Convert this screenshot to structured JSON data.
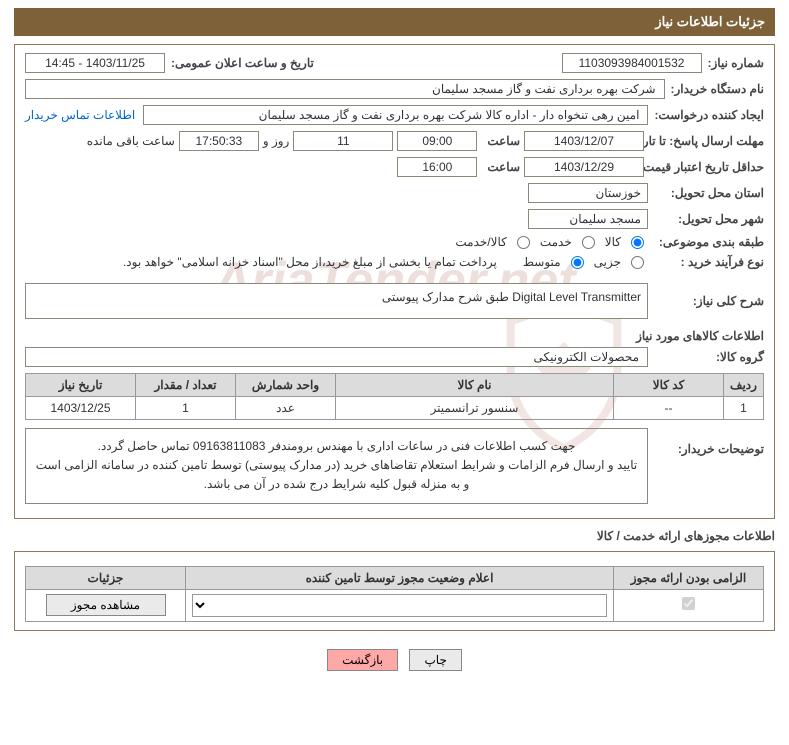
{
  "header": {
    "title": "جزئیات اطلاعات نیاز"
  },
  "need": {
    "number_label": "شماره نیاز:",
    "number": "1103093984001532",
    "announce_label": "تاریخ و ساعت اعلان عمومی:",
    "announce": "1403/11/25 - 14:45",
    "buyer_org_label": "نام دستگاه خریدار:",
    "buyer_org": "شرکت بهره برداری نفت و گاز مسجد سلیمان",
    "requester_label": "ایجاد کننده درخواست:",
    "requester": "امین رهی تنخواه دار - اداره کالا  شرکت بهره برداری نفت و گاز مسجد سلیمان",
    "buyer_contact_link": "اطلاعات تماس خریدار",
    "resp_deadline_label": "مهلت ارسال پاسخ: تا تاریخ:",
    "resp_date": "1403/12/07",
    "time_label": "ساعت",
    "resp_time": "09:00",
    "days": "11",
    "days_after": "روز و",
    "countdown": "17:50:33",
    "remaining_label": "ساعت باقی مانده",
    "price_validity_label": "حداقل تاریخ اعتبار قیمت: تا تاریخ:",
    "price_date": "1403/12/29",
    "price_time": "16:00",
    "province_label": "استان محل تحویل:",
    "province": "خوزستان",
    "city_label": "شهر محل تحویل:",
    "city": "مسجد سلیمان",
    "class_label": "طبقه بندی موضوعی:",
    "class_opts": {
      "goods": "کالا",
      "service": "خدمت",
      "both": "کالا/خدمت"
    },
    "process_label": "نوع فرآیند خرید :",
    "process_opts": {
      "partial": "جزیی",
      "medium": "متوسط"
    },
    "process_note": "پرداخت تمام یا بخشی از مبلغ خرید،از محل \"اسناد خزانه اسلامی\" خواهد بود.",
    "desc_label": "شرح کلی نیاز:",
    "desc": "Digital Level Transmitter طبق شرح مدارک پیوستی",
    "goods_info_title": "اطلاعات کالاهای مورد نیاز",
    "group_label": "گروه کالا:",
    "group": "محصولات الکترونیکی"
  },
  "table": {
    "headers": {
      "row": "ردیف",
      "code": "کد کالا",
      "name": "نام کالا",
      "unit": "واحد شمارش",
      "qty": "تعداد / مقدار",
      "date": "تاریخ نیاز"
    },
    "rows": [
      {
        "row": "1",
        "code": "--",
        "name": "سنسور ترانسمیتر",
        "unit": "عدد",
        "qty": "1",
        "date": "1403/12/25"
      }
    ]
  },
  "notes": {
    "label": "توضیحات خریدار:",
    "line1": "جهت کسب اطلاعات فنی در ساعات اداری با مهندس برومندفر  09163811083  تماس حاصل گردد.",
    "line2": "تایید و ارسال فرم الزامات و شرایط استعلام تقاضاهای خرید (در مدارک پیوستی) توسط تامین کننده در سامانه الزامی است و به منزله قبول کلیه شرایط درج شده در آن می باشد."
  },
  "license": {
    "section_label": "اطلاعات مجوزهای ارائه خدمت / کالا",
    "headers": {
      "mandatory": "الزامی بودن ارائه مجوز",
      "status": "اعلام وضعیت مجوز توسط تامین کننده",
      "details": "جزئیات"
    },
    "view_btn": "مشاهده مجوز"
  },
  "footer": {
    "print": "چاپ",
    "back": "بازگشت"
  },
  "watermark": "AriaTender.net"
}
